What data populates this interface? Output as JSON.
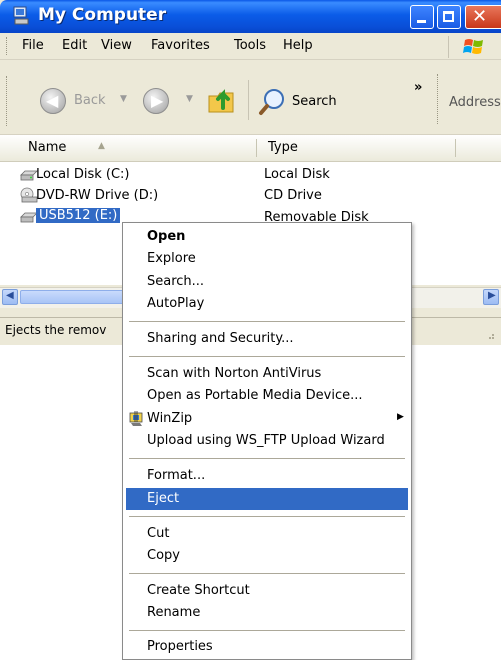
{
  "window": {
    "title": "My Computer"
  },
  "menubar": {
    "items": [
      "File",
      "Edit",
      "View",
      "Favorites",
      "Tools",
      "Help"
    ]
  },
  "toolbar": {
    "back_label": "Back",
    "search_label": "Search",
    "chevron": "»",
    "address_label": "Address"
  },
  "list": {
    "columns": [
      "Name",
      "Type"
    ],
    "rows": [
      {
        "name": "Local Disk (C:)",
        "type": "Local Disk"
      },
      {
        "name": "DVD-RW Drive (D:)",
        "type": "CD Drive"
      },
      {
        "name": "USB512 (E:)",
        "type": "Removable Disk"
      }
    ]
  },
  "statusbar": {
    "text": "Ejects the remov"
  },
  "context_menu": {
    "open": "Open",
    "explore": "Explore",
    "search": "Search...",
    "autoplay": "AutoPlay",
    "sharing": "Sharing and Security...",
    "scan": "Scan with Norton AntiVirus",
    "portable": "Open as Portable Media Device...",
    "winzip": "WinZip",
    "upload": "Upload using WS_FTP Upload Wizard",
    "format": "Format...",
    "eject": "Eject",
    "cut": "Cut",
    "copy": "Copy",
    "shortcut": "Create Shortcut",
    "rename": "Rename",
    "properties": "Properties"
  },
  "colors": {
    "titlebar": "#0A57E6",
    "highlight": "#316AC5",
    "chrome": "#ECE9D8"
  }
}
